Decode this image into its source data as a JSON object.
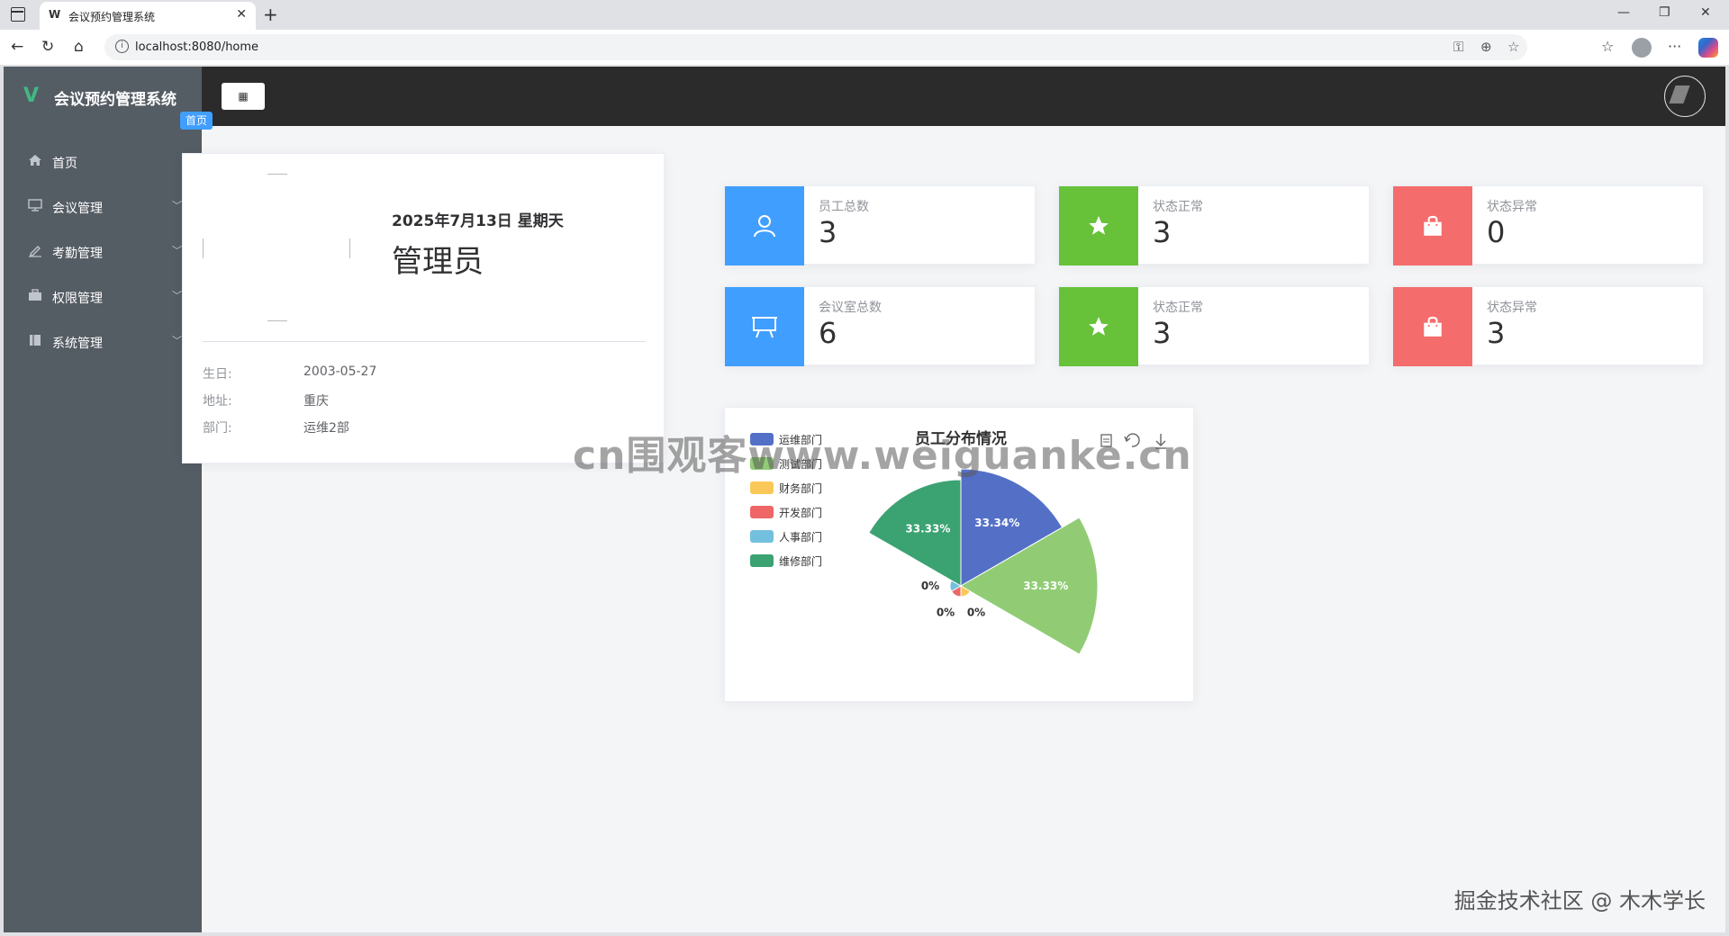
{
  "browser": {
    "tab_favicon": "W",
    "tab_title": "会议预约管理系统",
    "tab_close": "✕",
    "new_tab": "+",
    "url": "localhost:8080/home"
  },
  "app": {
    "logo_mark": "V",
    "name": "会议预约管理系统",
    "collapse_icon": "▦"
  },
  "sidebar": {
    "items": [
      {
        "label": "首页",
        "icon": "home-icon"
      },
      {
        "label": "会议管理",
        "icon": "monitor-icon"
      },
      {
        "label": "考勤管理",
        "icon": "edit-icon"
      },
      {
        "label": "权限管理",
        "icon": "briefcase-icon"
      },
      {
        "label": "系统管理",
        "icon": "notebook-icon"
      }
    ]
  },
  "breadcrumb": "首页",
  "profile": {
    "date": "2025年7月13日 星期天",
    "role": "管理员",
    "fields": [
      {
        "label": "生日:",
        "value": "2003-05-27"
      },
      {
        "label": "地址:",
        "value": "重庆"
      },
      {
        "label": "部门:",
        "value": "运维2部"
      }
    ]
  },
  "stats": [
    {
      "label": "员工总数",
      "value": "3",
      "color": "#409eff",
      "icon": "user-icon"
    },
    {
      "label": "状态正常",
      "value": "3",
      "color": "#67c23a",
      "icon": "star-icon"
    },
    {
      "label": "状态异常",
      "value": "0",
      "color": "#f56c6c",
      "icon": "bag-icon"
    },
    {
      "label": "会议室总数",
      "value": "6",
      "color": "#409eff",
      "icon": "presentation-icon"
    },
    {
      "label": "状态正常",
      "value": "3",
      "color": "#67c23a",
      "icon": "star-icon"
    },
    {
      "label": "状态异常",
      "value": "3",
      "color": "#f56c6c",
      "icon": "bag-icon"
    }
  ],
  "chart_data": {
    "type": "pie",
    "title": "员工分布情况",
    "rose": true,
    "legend_position": "top-left",
    "series": [
      {
        "name": "运维部门",
        "value": 33.34,
        "label": "33.34%",
        "color": "#5470c6"
      },
      {
        "name": "测试部门",
        "value": 33.33,
        "label": "33.33%",
        "color": "#91cc75"
      },
      {
        "name": "财务部门",
        "value": 0,
        "label": "0%",
        "color": "#fac858"
      },
      {
        "name": "开发部门",
        "value": 0,
        "label": "0%",
        "color": "#ee6666"
      },
      {
        "name": "人事部门",
        "value": 0,
        "label": "0%",
        "color": "#73c0de"
      },
      {
        "name": "维修部门",
        "value": 33.33,
        "label": "33.33%",
        "color": "#3ba272"
      }
    ]
  },
  "watermark": "cn围观客www.weiguanke.cn",
  "credit": "掘金技术社区 @ 木木学长"
}
